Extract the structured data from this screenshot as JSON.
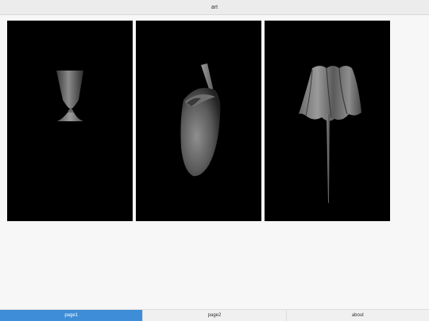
{
  "header": {
    "title": "art"
  },
  "gallery": {
    "items": [
      {
        "name": "goblet-artwork"
      },
      {
        "name": "pitcher-artwork"
      },
      {
        "name": "drapery-artwork"
      }
    ]
  },
  "tabs": [
    {
      "label": "page1",
      "active": true
    },
    {
      "label": "page2",
      "active": false
    },
    {
      "label": "about",
      "active": false
    }
  ],
  "colors": {
    "accent": "#3d8dd8",
    "tile_background": "#000000",
    "page_background": "#f7f7f7",
    "header_background": "#ececec"
  }
}
